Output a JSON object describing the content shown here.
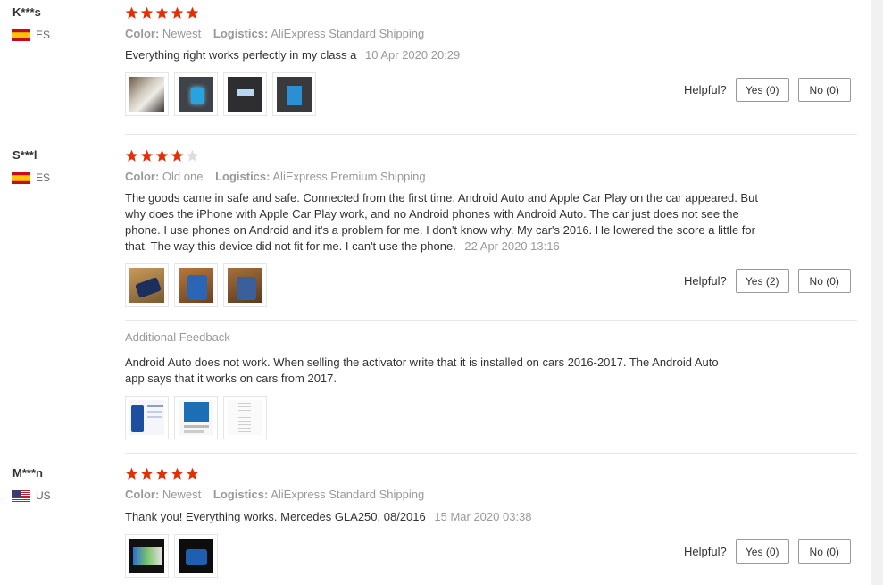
{
  "labels": {
    "color": "Color:",
    "logistics": "Logistics:",
    "helpful": "Helpful?",
    "additional_feedback": "Additional Feedback"
  },
  "colors": {
    "star_filled": "#e62e04",
    "star_empty": "#dddddd"
  },
  "reviews": [
    {
      "user": "K***s",
      "country": "ES",
      "flag": "spain-flag",
      "rating": 5,
      "color_value": "Newest",
      "logistics_value": "AliExpress Standard Shipping",
      "text": "Everything right works perfectly in my class a",
      "date": "10 Apr 2020 20:29",
      "yes": "Yes (0)",
      "no": "No (0)"
    },
    {
      "user": "S***l",
      "country": "ES",
      "flag": "spain-flag",
      "rating": 4,
      "color_value": "Old one",
      "logistics_value": "AliExpress Premium Shipping",
      "text": "The goods came in safe and safe. Connected from the first time. Android Auto and Apple Car Play on the car appeared. But why does the iPhone with Apple Car Play work, and no Android phones with Android Auto. The car just does not see the phone. I use phones on Android and it's a problem for me. I don't know why. My car's 2016. He lowered the score a little for that. The way this device did not fit for me. I can't use the phone.",
      "date": "22 Apr 2020 13:16",
      "yes": "Yes (2)",
      "no": "No (0)",
      "feedback_text": "Android Auto does not work. When selling the activator write that it is installed on cars 2016-2017. The Android Auto app says that it works on cars from 2017."
    },
    {
      "user": "M***n",
      "country": "US",
      "flag": "us-flag",
      "rating": 5,
      "color_value": "Newest",
      "logistics_value": "AliExpress Standard Shipping",
      "text": "Thank you! Everything works. Mercedes GLA250, 08/2016",
      "date": "15 Mar 2020 03:38",
      "yes": "Yes (0)",
      "no": "No (0)"
    }
  ]
}
